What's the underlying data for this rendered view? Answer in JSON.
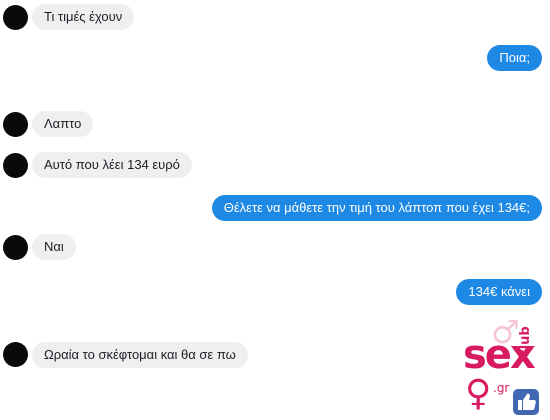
{
  "conversation": {
    "messages": [
      {
        "direction": "incoming",
        "text": "Τι τιμές έχουν"
      },
      {
        "direction": "outgoing",
        "text": "Ποια;"
      },
      {
        "direction": "incoming",
        "text": "Λαπτο"
      },
      {
        "direction": "incoming",
        "text": "Αυτό που λέει 134 ευρό"
      },
      {
        "direction": "outgoing",
        "text": "Θέλετε να μάθετε την τιμή του λάπτοπ που έχει 134€;"
      },
      {
        "direction": "incoming",
        "text": "Ναι"
      },
      {
        "direction": "outgoing",
        "text": "134€ κάνει"
      },
      {
        "direction": "incoming",
        "text": "Ωραία το σκέφτομαι και θα σε πω"
      }
    ]
  },
  "watermark": {
    "brand_text": "sex",
    "side_text": "club",
    "domain_text": ".gr",
    "badge_icon": "thumbs-up-icon",
    "color": "#d81b60"
  },
  "colors": {
    "incoming_bubble": "#eeeff1",
    "outgoing_bubble": "#1e88e5",
    "avatar": "#0a0a0a"
  }
}
